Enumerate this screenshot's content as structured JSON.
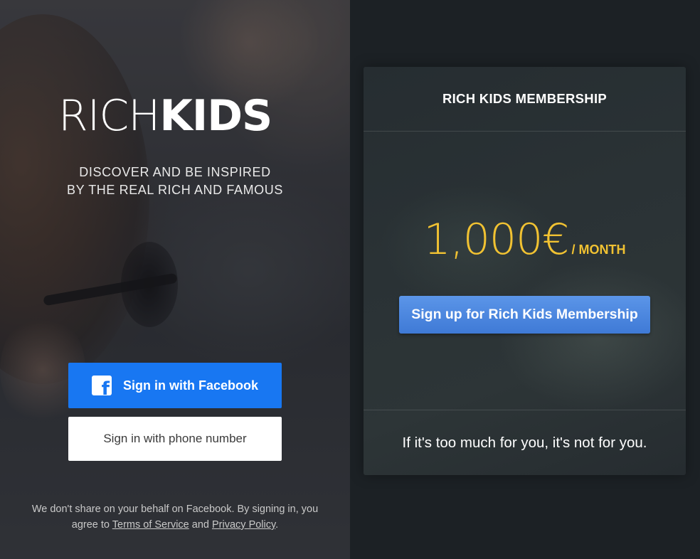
{
  "brand": {
    "logo_light": "RICH",
    "logo_bold": "KIDS",
    "tagline_line1": "DISCOVER AND BE INSPIRED",
    "tagline_line2": "BY THE REAL RICH AND FAMOUS"
  },
  "auth": {
    "facebook_label": "Sign in with Facebook",
    "facebook_icon": "facebook-icon",
    "facebook_color": "#1877f2",
    "phone_label": "Sign in with phone number"
  },
  "disclaimer": {
    "text_before": "We don't share on your behalf on Facebook. By signing in, you agree to ",
    "terms_link": "Terms of Service",
    "and": " and ",
    "privacy_link": "Privacy Policy",
    "period": "."
  },
  "membership": {
    "title": "RICH KIDS MEMBERSHIP",
    "price": "1,000€",
    "period": "/ MONTH",
    "signup_label": "Sign up for Rich Kids Membership",
    "footer_text": "If it's too much for you, it's not for you.",
    "accent_color": "#f1c232",
    "button_color": "#4a86e0"
  }
}
